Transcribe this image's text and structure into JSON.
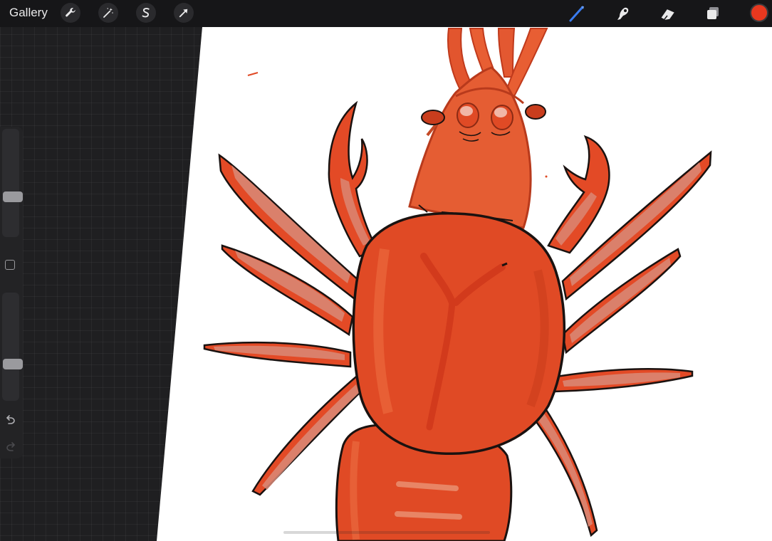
{
  "app": {
    "gallery_label": "Gallery"
  },
  "toolbar_left": [
    {
      "name": "actions",
      "icon": "wrench-icon"
    },
    {
      "name": "adjustments",
      "icon": "magic-wand-icon"
    },
    {
      "name": "selection",
      "icon": "selection-s-icon"
    },
    {
      "name": "transform",
      "icon": "arrow-cursor-icon"
    }
  ],
  "toolbar_right": [
    {
      "name": "brush",
      "icon": "brush-icon",
      "active": true
    },
    {
      "name": "smudge",
      "icon": "smudge-finger-icon"
    },
    {
      "name": "eraser",
      "icon": "eraser-icon"
    },
    {
      "name": "layers",
      "icon": "layers-icon"
    }
  ],
  "colors": {
    "active_color": "#e8381f",
    "brush_active": "#3a7cf0",
    "lobster_body": "#e04a25",
    "lobster_light": "#ec6a3e",
    "lobster_pale": "#d98a78",
    "outline": "#1a1210"
  },
  "sidebar": {
    "brush_size": 0.36,
    "opacity": 0.32
  }
}
